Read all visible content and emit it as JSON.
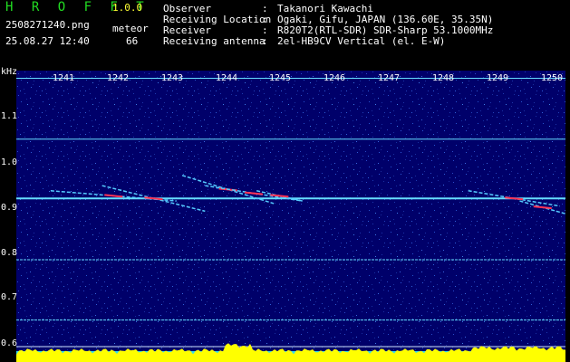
{
  "app": {
    "name": "H R O F F T",
    "version": "1.0.0",
    "filename": "2508271240.png",
    "datetime": "25.08.27 12:40",
    "mode_label": "meteor",
    "count": "66"
  },
  "info": [
    {
      "key": "Observer",
      "sep": ":",
      "value": "Takanori Kawachi"
    },
    {
      "key": "Receiving Location",
      "sep": ":",
      "value": "Ogaki, Gifu, JAPAN (136.60E, 35.35N)"
    },
    {
      "key": "Receiver",
      "sep": ":",
      "value": "R820T2(RTL-SDR) SDR-Sharp 53.1000MHz"
    },
    {
      "key": "Receiving antenna",
      "sep": ":",
      "value": "2el-HB9CV Vertical (el. E-W)"
    }
  ],
  "axes": {
    "y_unit": "kHz",
    "y_ticks": [
      "1.1",
      "1.0",
      "0.9",
      "0.8",
      "0.7",
      "0.6"
    ],
    "x_ticks": [
      "1241",
      "1242",
      "1243",
      "1244",
      "1245",
      "1246",
      "1247",
      "1248",
      "1249",
      "1250"
    ]
  },
  "colors": {
    "title_green": "#22dd22",
    "version_yellow": "#ffff33",
    "background_blue": "#00006a",
    "carrier_cyan": "#66ddff",
    "meteor_red": "#ff3355",
    "level_yellow": "#ffff00",
    "level_cyan": "#33ddee"
  },
  "chart_data": {
    "type": "heatmap",
    "title": "",
    "xlabel": "",
    "ylabel": "kHz",
    "xlim": [
      1240.6,
      1250.2
    ],
    "ylim": [
      0.59,
      1.16
    ],
    "carriers_khz": [
      1.145,
      1.026,
      0.91,
      0.79,
      0.672,
      0.62,
      0.605
    ],
    "meteors": [
      {
        "x0": 1241.2,
        "x1": 1243.4,
        "y0": 0.925,
        "y1": 0.905
      },
      {
        "x0": 1242.1,
        "x1": 1243.9,
        "y0": 0.935,
        "y1": 0.885
      },
      {
        "x0": 1243.5,
        "x1": 1245.1,
        "y0": 0.955,
        "y1": 0.9
      },
      {
        "x0": 1243.9,
        "x1": 1245.6,
        "y0": 0.935,
        "y1": 0.905
      },
      {
        "x0": 1244.8,
        "x1": 1245.6,
        "y0": 0.925,
        "y1": 0.905
      },
      {
        "x0": 1248.5,
        "x1": 1250.1,
        "y0": 0.925,
        "y1": 0.895
      },
      {
        "x0": 1249.4,
        "x1": 1250.2,
        "y0": 0.905,
        "y1": 0.88
      }
    ]
  }
}
